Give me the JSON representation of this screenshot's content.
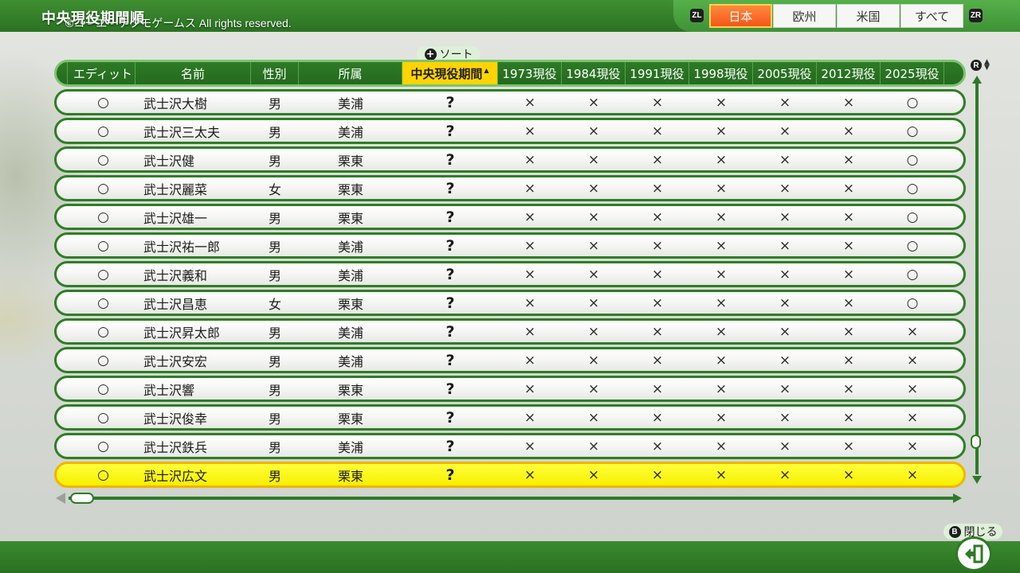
{
  "header": {
    "title": "中央現役期間順",
    "copyright": "©コーエーテクモゲームス All rights reserved."
  },
  "region_tabs": {
    "left_hint": "ZL",
    "right_hint": "ZR",
    "items": [
      {
        "label": "日本",
        "active": true
      },
      {
        "label": "欧州",
        "active": false
      },
      {
        "label": "米国",
        "active": false
      },
      {
        "label": "すべて",
        "active": false
      }
    ]
  },
  "sort": {
    "label": "ソート",
    "icon": "plus-button-icon"
  },
  "table": {
    "columns": [
      "エディット",
      "名前",
      "性別",
      "所属",
      "中央現役期間",
      "1973現役",
      "1984現役",
      "1991現役",
      "1998現役",
      "2005現役",
      "2012現役",
      "2025現役"
    ],
    "sorted_column": "中央現役期間",
    "sort_arrow": "▲",
    "rows": [
      {
        "edit": "○",
        "name": "武士沢大樹",
        "sex": "男",
        "team": "美浦",
        "period": "?",
        "marks": [
          "×",
          "×",
          "×",
          "×",
          "×",
          "×",
          "○"
        ]
      },
      {
        "edit": "○",
        "name": "武士沢三太夫",
        "sex": "男",
        "team": "美浦",
        "period": "?",
        "marks": [
          "×",
          "×",
          "×",
          "×",
          "×",
          "×",
          "○"
        ]
      },
      {
        "edit": "○",
        "name": "武士沢健",
        "sex": "男",
        "team": "栗東",
        "period": "?",
        "marks": [
          "×",
          "×",
          "×",
          "×",
          "×",
          "×",
          "○"
        ]
      },
      {
        "edit": "○",
        "name": "武士沢麗菜",
        "sex": "女",
        "team": "栗東",
        "period": "?",
        "marks": [
          "×",
          "×",
          "×",
          "×",
          "×",
          "×",
          "○"
        ]
      },
      {
        "edit": "○",
        "name": "武士沢雄一",
        "sex": "男",
        "team": "栗東",
        "period": "?",
        "marks": [
          "×",
          "×",
          "×",
          "×",
          "×",
          "×",
          "○"
        ]
      },
      {
        "edit": "○",
        "name": "武士沢祐一郎",
        "sex": "男",
        "team": "美浦",
        "period": "?",
        "marks": [
          "×",
          "×",
          "×",
          "×",
          "×",
          "×",
          "○"
        ]
      },
      {
        "edit": "○",
        "name": "武士沢義和",
        "sex": "男",
        "team": "美浦",
        "period": "?",
        "marks": [
          "×",
          "×",
          "×",
          "×",
          "×",
          "×",
          "○"
        ]
      },
      {
        "edit": "○",
        "name": "武士沢昌恵",
        "sex": "女",
        "team": "栗東",
        "period": "?",
        "marks": [
          "×",
          "×",
          "×",
          "×",
          "×",
          "×",
          "○"
        ]
      },
      {
        "edit": "○",
        "name": "武士沢昇太郎",
        "sex": "男",
        "team": "美浦",
        "period": "?",
        "marks": [
          "×",
          "×",
          "×",
          "×",
          "×",
          "×",
          "×"
        ]
      },
      {
        "edit": "○",
        "name": "武士沢安宏",
        "sex": "男",
        "team": "美浦",
        "period": "?",
        "marks": [
          "×",
          "×",
          "×",
          "×",
          "×",
          "×",
          "×"
        ]
      },
      {
        "edit": "○",
        "name": "武士沢響",
        "sex": "男",
        "team": "栗東",
        "period": "?",
        "marks": [
          "×",
          "×",
          "×",
          "×",
          "×",
          "×",
          "×"
        ]
      },
      {
        "edit": "○",
        "name": "武士沢俊幸",
        "sex": "男",
        "team": "栗東",
        "period": "?",
        "marks": [
          "×",
          "×",
          "×",
          "×",
          "×",
          "×",
          "×"
        ]
      },
      {
        "edit": "○",
        "name": "武士沢鉄兵",
        "sex": "男",
        "team": "美浦",
        "period": "?",
        "marks": [
          "×",
          "×",
          "×",
          "×",
          "×",
          "×",
          "×"
        ]
      },
      {
        "edit": "○",
        "name": "武士沢広文",
        "sex": "男",
        "team": "栗東",
        "period": "?",
        "marks": [
          "×",
          "×",
          "×",
          "×",
          "×",
          "×",
          "×"
        ],
        "selected": true
      }
    ]
  },
  "scroll": {
    "vertical_hint": "R"
  },
  "footer": {
    "close_label": "閉じる",
    "close_hint": "B",
    "close_icon": "exit-door-icon"
  },
  "colors": {
    "header_green": "#2e7a26",
    "active_tab": "#f4561a",
    "sorted_header": "#ffd400",
    "selected_row": "#ffff3a"
  }
}
